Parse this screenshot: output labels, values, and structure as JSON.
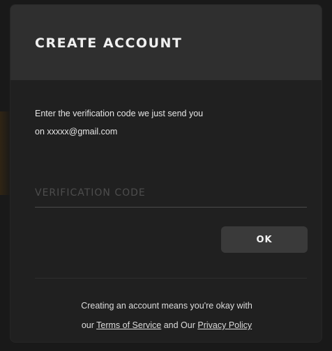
{
  "dialog": {
    "title": "CREATE ACCOUNT",
    "intro_line1": "Enter the verification code we just send you",
    "intro_line2": "on xxxxx@gmail.com",
    "code_input": {
      "value": "",
      "placeholder": "VERIFICATION CODE"
    },
    "ok_label": "OK",
    "legal": {
      "line1": "Creating an account means you're okay with",
      "line2_prefix": "our",
      "terms_link": "Terms of Service",
      "line2_middle": "and Our",
      "privacy_link": "Privacy Policy"
    }
  },
  "colors": {
    "background": "#191919",
    "modal": "#202020",
    "header": "#2f2f2f",
    "button": "#3a3a3a",
    "text": "#f0f0f0"
  }
}
